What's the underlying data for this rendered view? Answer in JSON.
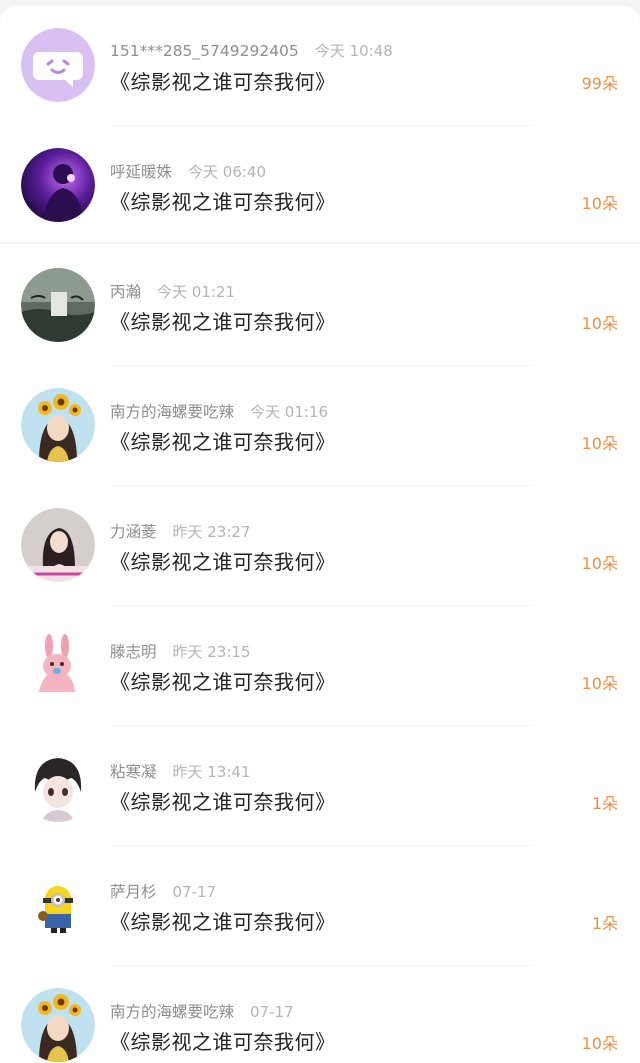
{
  "rows": [
    {
      "name": "151***285_5749292405",
      "time": "今天 10:48",
      "book": "《综影视之谁可奈我何》",
      "flowers": "99朵",
      "avatar_icon": "chat-bubble-avatar-icon"
    },
    {
      "name": "呼延暖姝",
      "time": "今天 06:40",
      "book": "《综影视之谁可奈我何》",
      "flowers": "10朵",
      "avatar_icon": "purple-portrait-avatar-icon"
    },
    {
      "name": "丙瀚",
      "time": "今天 01:21",
      "book": "《综影视之谁可奈我何》",
      "flowers": "10朵",
      "avatar_icon": "dark-landscape-avatar-icon"
    },
    {
      "name": "南方的海螺要吃辣",
      "time": "今天 01:16",
      "book": "《综影视之谁可奈我何》",
      "flowers": "10朵",
      "avatar_icon": "sunflower-girl-avatar-icon"
    },
    {
      "name": "力涵菱",
      "time": "昨天 23:27",
      "book": "《综影视之谁可奈我何》",
      "flowers": "10朵",
      "avatar_icon": "woman-portrait-avatar-icon"
    },
    {
      "name": "滕志明",
      "time": "昨天 23:15",
      "book": "《综影视之谁可奈我何》",
      "flowers": "10朵",
      "avatar_icon": "pink-rabbit-avatar-icon"
    },
    {
      "name": "粘寒凝",
      "time": "昨天 13:41",
      "book": "《综影视之谁可奈我何》",
      "flowers": "1朵",
      "avatar_icon": "anime-boy-avatar-icon"
    },
    {
      "name": "萨月杉",
      "time": "07-17",
      "book": "《综影视之谁可奈我何》",
      "flowers": "1朵",
      "avatar_icon": "minion-avatar-icon"
    },
    {
      "name": "南方的海螺要吃辣",
      "time": "07-17",
      "book": "《综影视之谁可奈我何》",
      "flowers": "10朵",
      "avatar_icon": "sunflower-girl-avatar-icon"
    }
  ],
  "colors": {
    "accent": "#e8904a",
    "text": "#222222",
    "meta": "#9a9a9a"
  }
}
